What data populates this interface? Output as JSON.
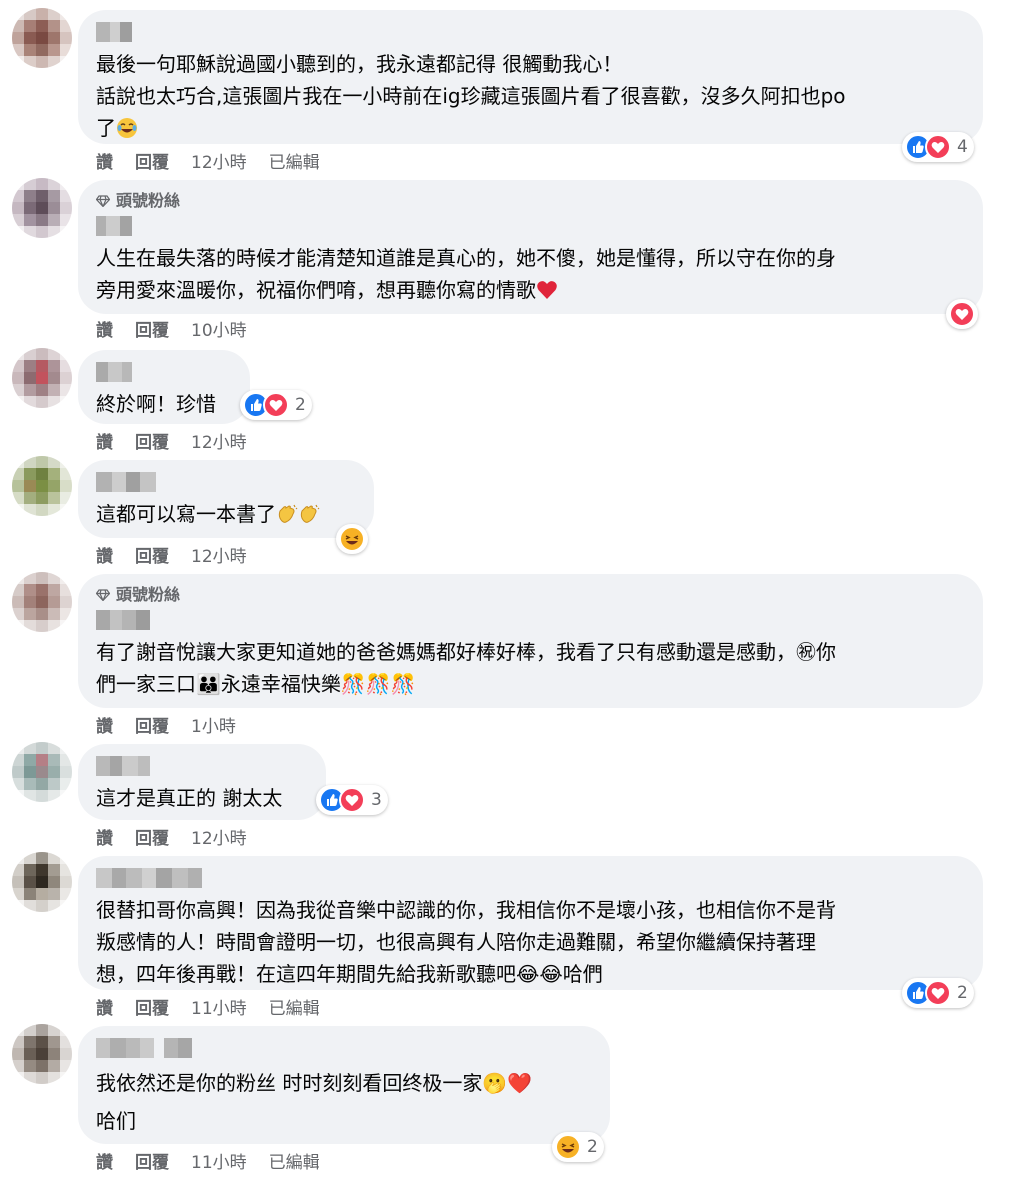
{
  "comments": [
    {
      "badge": "",
      "text_lines": [
        "最後一句耶穌說過國小聽到的，我永遠都記得 很觸動我心！",
        "話說也太巧合,這張圖片我在一小時前在ig珍藏這張圖片看了很喜歡，沒多久阿扣也po",
        "了"
      ],
      "trailing_emoji": [
        "face-tears-of-joy-emoji"
      ],
      "actions": {
        "like": "讚",
        "reply": "回覆",
        "time": "12小時",
        "edited": "已編輯"
      },
      "reactions": {
        "icons": [
          "like",
          "love"
        ],
        "count": "4"
      }
    },
    {
      "badge": "頭號粉絲",
      "text_lines": [
        "人生在最失落的時候才能清楚知道誰是真心的，她不傻，她是懂得，所以守在你的身",
        "旁用愛來溫暖你，祝福你們唷，想再聽你寫的情歌"
      ],
      "trailing_emoji": [
        "red-heart-emoji"
      ],
      "actions": {
        "like": "讚",
        "reply": "回覆",
        "time": "10小時",
        "edited": ""
      },
      "reactions": {
        "icons": [
          "love"
        ],
        "count": ""
      }
    },
    {
      "badge": "",
      "text_lines": [
        "終於啊！珍惜"
      ],
      "trailing_emoji": [],
      "actions": {
        "like": "讚",
        "reply": "回覆",
        "time": "12小時",
        "edited": ""
      },
      "reactions": {
        "icons": [
          "like",
          "love"
        ],
        "count": "2"
      }
    },
    {
      "badge": "",
      "text_lines": [
        "這都可以寫一本書了"
      ],
      "trailing_emoji": [
        "clapping-hands-emoji",
        "clapping-hands-emoji"
      ],
      "actions": {
        "like": "讚",
        "reply": "回覆",
        "time": "12小時",
        "edited": ""
      },
      "reactions": {
        "icons": [
          "haha"
        ],
        "count": ""
      }
    },
    {
      "badge": "頭號粉絲",
      "text_lines": [
        "有了謝音悅讓大家更知道她的爸爸媽媽都好棒好棒，我看了只有感動還是感動，㊗你",
        "們一家三口👪永遠幸福快樂🎊🎊🎊"
      ],
      "trailing_emoji": [],
      "actions": {
        "like": "讚",
        "reply": "回覆",
        "time": "1小時",
        "edited": ""
      },
      "reactions": {
        "icons": [],
        "count": ""
      }
    },
    {
      "badge": "",
      "text_lines": [
        "這才是真正的 謝太太"
      ],
      "trailing_emoji": [],
      "actions": {
        "like": "讚",
        "reply": "回覆",
        "time": "12小時",
        "edited": ""
      },
      "reactions": {
        "icons": [
          "like",
          "love"
        ],
        "count": "3"
      }
    },
    {
      "badge": "",
      "text_lines": [
        "很替扣哥你高興！因為我從音樂中認識的你，我相信你不是壞小孩，也相信你不是背",
        "叛感情的人！時間會證明一切，也很高興有人陪你走過難關，希望你繼續保持著理",
        "想，四年後再戰！在這四年期間先給我新歌聽吧😂😂哈們"
      ],
      "trailing_emoji": [],
      "actions": {
        "like": "讚",
        "reply": "回覆",
        "time": "11小時",
        "edited": "已編輯"
      },
      "reactions": {
        "icons": [
          "like",
          "love"
        ],
        "count": "2"
      }
    },
    {
      "badge": "",
      "text_lines": [
        "我依然还是你的粉丝 时时刻刻看回终极一家🫢❤️",
        "哈们"
      ],
      "trailing_emoji": [],
      "actions": {
        "like": "讚",
        "reply": "回覆",
        "time": "11小時",
        "edited": "已編輯"
      },
      "reactions": {
        "icons": [
          "haha"
        ],
        "count": "2"
      }
    }
  ],
  "colors": {
    "bubble": "#f0f2f5",
    "secondary_text": "#65676b",
    "like_blue": "#1877f2",
    "love_red": "#f33e58",
    "haha_yellow": "#f7b125"
  }
}
